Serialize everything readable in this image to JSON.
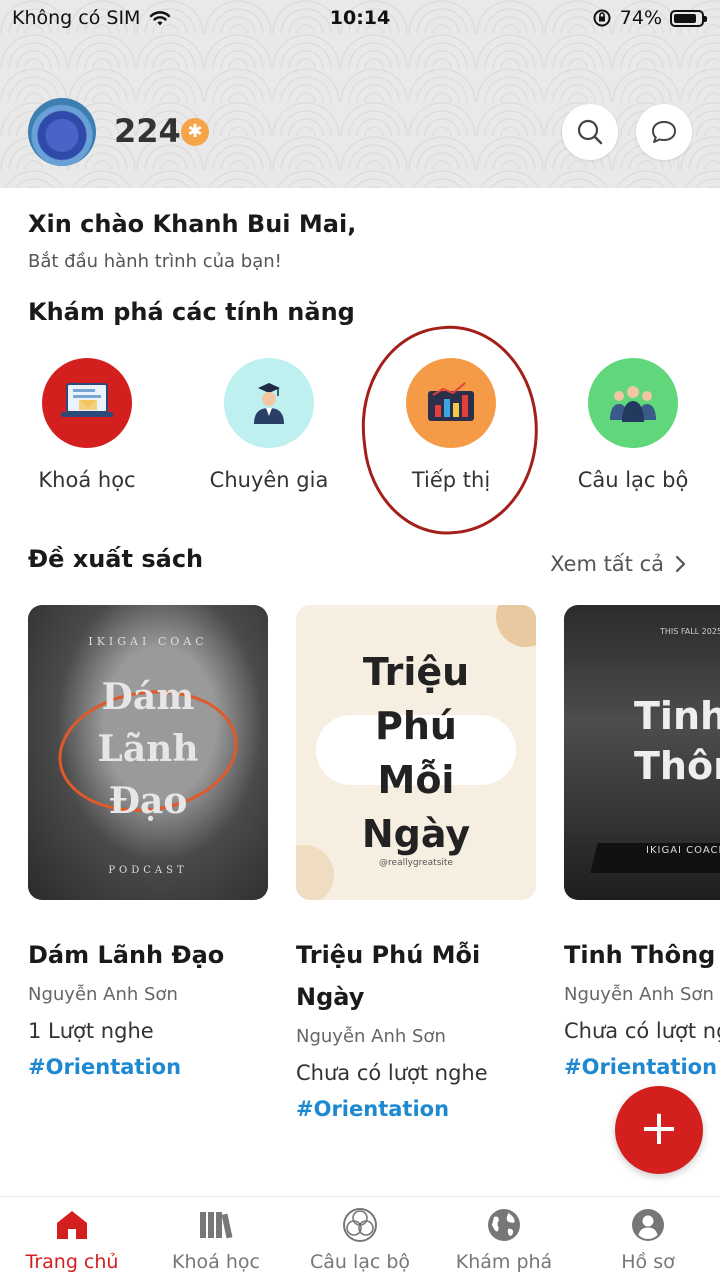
{
  "status_bar": {
    "carrier": "Không có SIM",
    "time": "10:14",
    "battery": "74%"
  },
  "header": {
    "points": "224"
  },
  "greeting": {
    "title": "Xin chào Khanh Bui Mai,",
    "subtitle": "Bắt đầu hành trình của bạn!"
  },
  "features": {
    "title": "Khám phá các tính năng",
    "items": [
      {
        "label": "Khoá học",
        "color": "#d3201f",
        "icon": "course-icon"
      },
      {
        "label": "Chuyên gia",
        "color": "#bff0f0",
        "icon": "expert-icon"
      },
      {
        "label": "Tiếp thị",
        "color": "#f59a47",
        "icon": "marketing-chart-icon"
      },
      {
        "label": "Câu lạc bộ",
        "color": "#5fd77a",
        "icon": "club-icon"
      }
    ]
  },
  "books": {
    "title": "Đề xuất sách",
    "see_all": "Xem tất cả",
    "items": [
      {
        "title": "Dám Lãnh Đạo",
        "author": "Nguyễn Anh Sơn",
        "listens": "1 Lượt nghe",
        "tag": "#Orientation",
        "cover_top": "IKIGAI COAC",
        "cover_l1": "Dám",
        "cover_l2": "Lãnh",
        "cover_l3": "Đạo",
        "cover_bottom": "PODCAST"
      },
      {
        "title": "Triệu Phú Mỗi Ngày",
        "author": "Nguyễn Anh Sơn",
        "listens": "Chưa có lượt nghe",
        "tag": "#Orientation",
        "cover_l1": "Triệu",
        "cover_l2": "Phú",
        "cover_l3": "Mỗi",
        "cover_l4": "Ngày",
        "cover_site": "@reallygreatsite"
      },
      {
        "title": "Tinh Thông",
        "author": "Nguyễn Anh Sơn",
        "listens": "Chưa có lượt ng",
        "tag": "#Orientation",
        "cover_small": "THIS FALL 2025",
        "cover_l1": "Tinh",
        "cover_l2": "Thôn",
        "cover_stage": "IKIGAI COACH"
      }
    ]
  },
  "nav": {
    "items": [
      {
        "label": "Trang chủ",
        "icon": "home-icon",
        "active": true
      },
      {
        "label": "Khoá học",
        "icon": "books-icon"
      },
      {
        "label": "Câu lạc bộ",
        "icon": "club-icon"
      },
      {
        "label": "Khám phá",
        "icon": "globe-icon"
      },
      {
        "label": "Hồ sơ",
        "icon": "profile-icon"
      }
    ]
  },
  "colors": {
    "accent": "#d3201f",
    "tag": "#1e88d0",
    "highlight_ring": "#a3201a"
  }
}
